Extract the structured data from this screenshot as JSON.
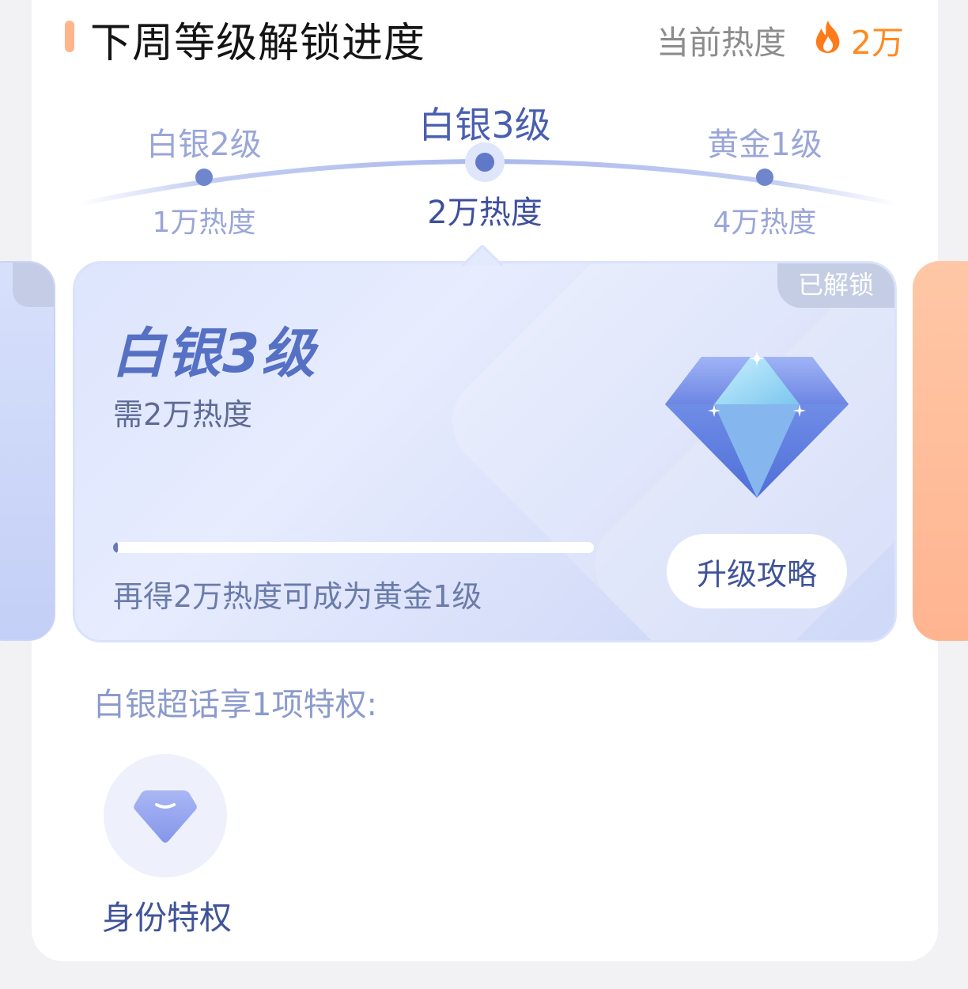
{
  "header": {
    "title": "下周等级解锁进度",
    "current_heat_label": "当前热度",
    "current_heat_value": "2万",
    "heat_icon": "fire-icon"
  },
  "levels": [
    {
      "name": "白银2级",
      "heat": "1万热度",
      "active": false
    },
    {
      "name": "白银3级",
      "heat": "2万热度",
      "active": true
    },
    {
      "name": "黄金1级",
      "heat": "4万热度",
      "active": false
    }
  ],
  "level_card": {
    "badge": "已解锁",
    "level_name": "白银3级",
    "requirement": "需2万热度",
    "progress": 0.01,
    "progress_text": "再得2万热度可成为黄金1级",
    "guide_button": "升级攻略",
    "icon": "diamond-icon"
  },
  "privileges": {
    "title": "白银超话享1项特权:",
    "items": [
      {
        "label": "身份特权",
        "icon": "identity-diamond-icon"
      }
    ]
  },
  "colors": {
    "accent": "#ffb48a",
    "heat": "#ff8a1f",
    "primary": "#4a5fb0",
    "muted": "#9aa6d8"
  }
}
